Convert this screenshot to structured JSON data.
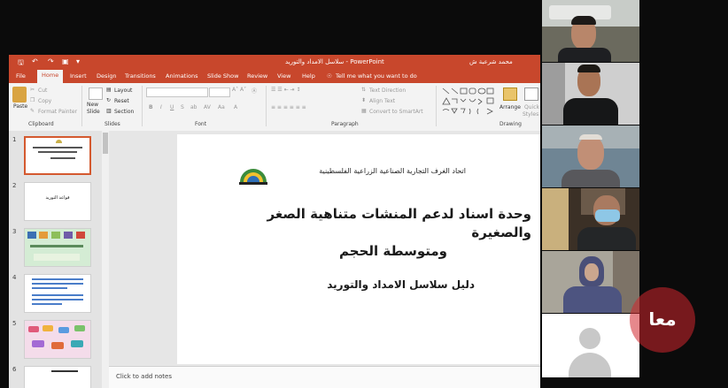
{
  "window": {
    "title": "سلاسل الامداد والتوريد  -  PowerPoint",
    "search_prompt": "Tell me what you want to do",
    "presenter_name": "محمد شرعبة ش"
  },
  "menu": [
    "File",
    "Home",
    "Insert",
    "Design",
    "Transitions",
    "Animations",
    "Slide Show",
    "Review",
    "View",
    "Help"
  ],
  "ribbon": {
    "clipboard": {
      "paste": "Paste",
      "cut": "Cut",
      "copy": "Copy",
      "format_painter": "Format Painter",
      "group": "Clipboard"
    },
    "slides": {
      "new_slide_line1": "New",
      "new_slide_line2": "Slide",
      "layout": "Layout",
      "reset": "Reset",
      "section": "Section",
      "group": "Slides"
    },
    "font": {
      "group": "Font"
    },
    "paragraph": {
      "text_direction": "Text Direction",
      "align_text": "Align Text",
      "convert_smartart": "Convert to SmartArt",
      "group": "Paragraph"
    },
    "drawing": {
      "arrange": "Arrange",
      "quick_styles_line1": "Quick",
      "quick_styles_line2": "Styles",
      "group": "Drawing"
    }
  },
  "thumbnails": [
    "1",
    "2",
    "3",
    "4",
    "5",
    "6"
  ],
  "thumb2_text": "قواعد التوريد",
  "slide": {
    "org_name": "اتحاد الغرف التجارية الصناعية الزراعية الفلسطينية",
    "heading_line1": "وحدة اسناد لدعم المنشات متناهية الصغر والصغيرة",
    "heading_line2": "ومتوسطة الحجم",
    "subtitle": "دليل سلاسل الامداد والتوريد"
  },
  "notes_placeholder": "Click to add notes",
  "watermark_text": "معا",
  "colors": {
    "accent": "#c8472c",
    "ribbon_bg": "#f3f3f3",
    "watermark": "#d2272d"
  }
}
